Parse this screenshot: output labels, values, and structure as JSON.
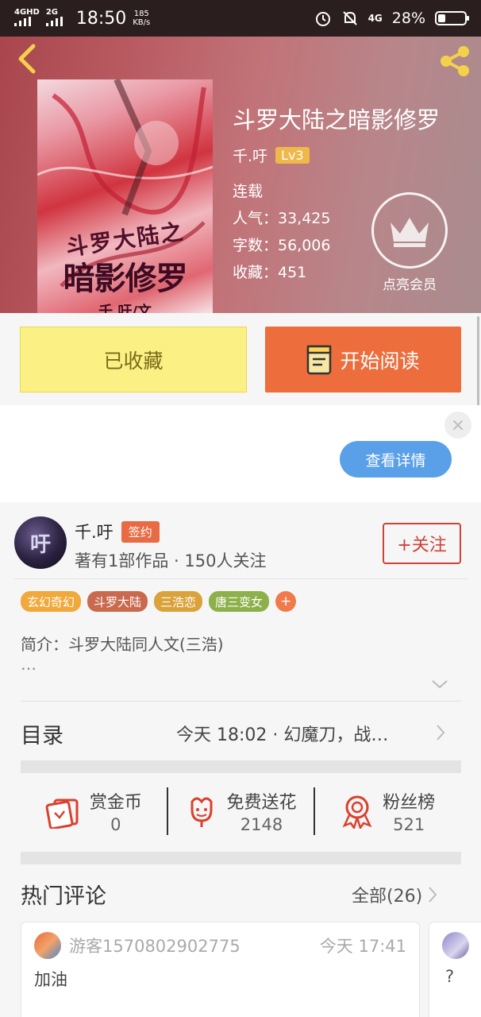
{
  "status_bar": {
    "network1": "4GHD",
    "network2": "2G",
    "time": "18:50",
    "speed_value": "185",
    "speed_unit": "KB/s",
    "network3": "4G",
    "battery": "28%",
    "battery_level": 0.28
  },
  "book": {
    "title": "斗罗大陆之暗影修罗",
    "author": "千.吁",
    "level": "Lv3",
    "status": "连载",
    "popularity": "人气：33,425",
    "word_count": "字数：56,006",
    "favorites": "收藏：451",
    "cover_text": {
      "line1": "斗罗大陆之",
      "line2": "暗影修罗",
      "line3": "千.吁/文"
    }
  },
  "vip": {
    "label": "点亮会员"
  },
  "actions": {
    "collected": "已收藏",
    "start_reading": "开始阅读"
  },
  "ad": {
    "close": "×",
    "detail_button": "查看详情"
  },
  "author": {
    "avatar_text": "吁",
    "name": "千.吁",
    "badge": "签约",
    "stats": "著有1部作品 · 150人关注",
    "follow": "+关注"
  },
  "tags": [
    {
      "label": "玄幻奇幻",
      "color": "#f0a93a"
    },
    {
      "label": "斗罗大陆",
      "color": "#c96a4f"
    },
    {
      "label": "三浩恋",
      "color": "#d9a23a"
    },
    {
      "label": "唐三变女",
      "color": "#8db04a"
    }
  ],
  "tag_more": "+",
  "intro": {
    "text": "简介：斗罗大陆同人文(三浩)",
    "more": "…"
  },
  "toc": {
    "label": "目录",
    "latest": "今天 18:02 · 幻魔刀，战…"
  },
  "stats": [
    {
      "label": "赏金币",
      "value": "0",
      "icon": "red-envelope-icon"
    },
    {
      "label": "免费送花",
      "value": "2148",
      "icon": "flower-icon"
    },
    {
      "label": "粉丝榜",
      "value": "521",
      "icon": "medal-icon"
    }
  ],
  "comments": {
    "label": "热门评论",
    "all": "全部(26)",
    "items": [
      {
        "user": "游客1570802902775",
        "time": "今天 17:41",
        "text": "加油"
      },
      {
        "text": "?"
      }
    ]
  },
  "colors": {
    "accent_orange": "#ed6d3c",
    "collected_yellow": "#fbf083",
    "follow_red": "#cf4238",
    "detail_blue": "#5aa0e8"
  }
}
